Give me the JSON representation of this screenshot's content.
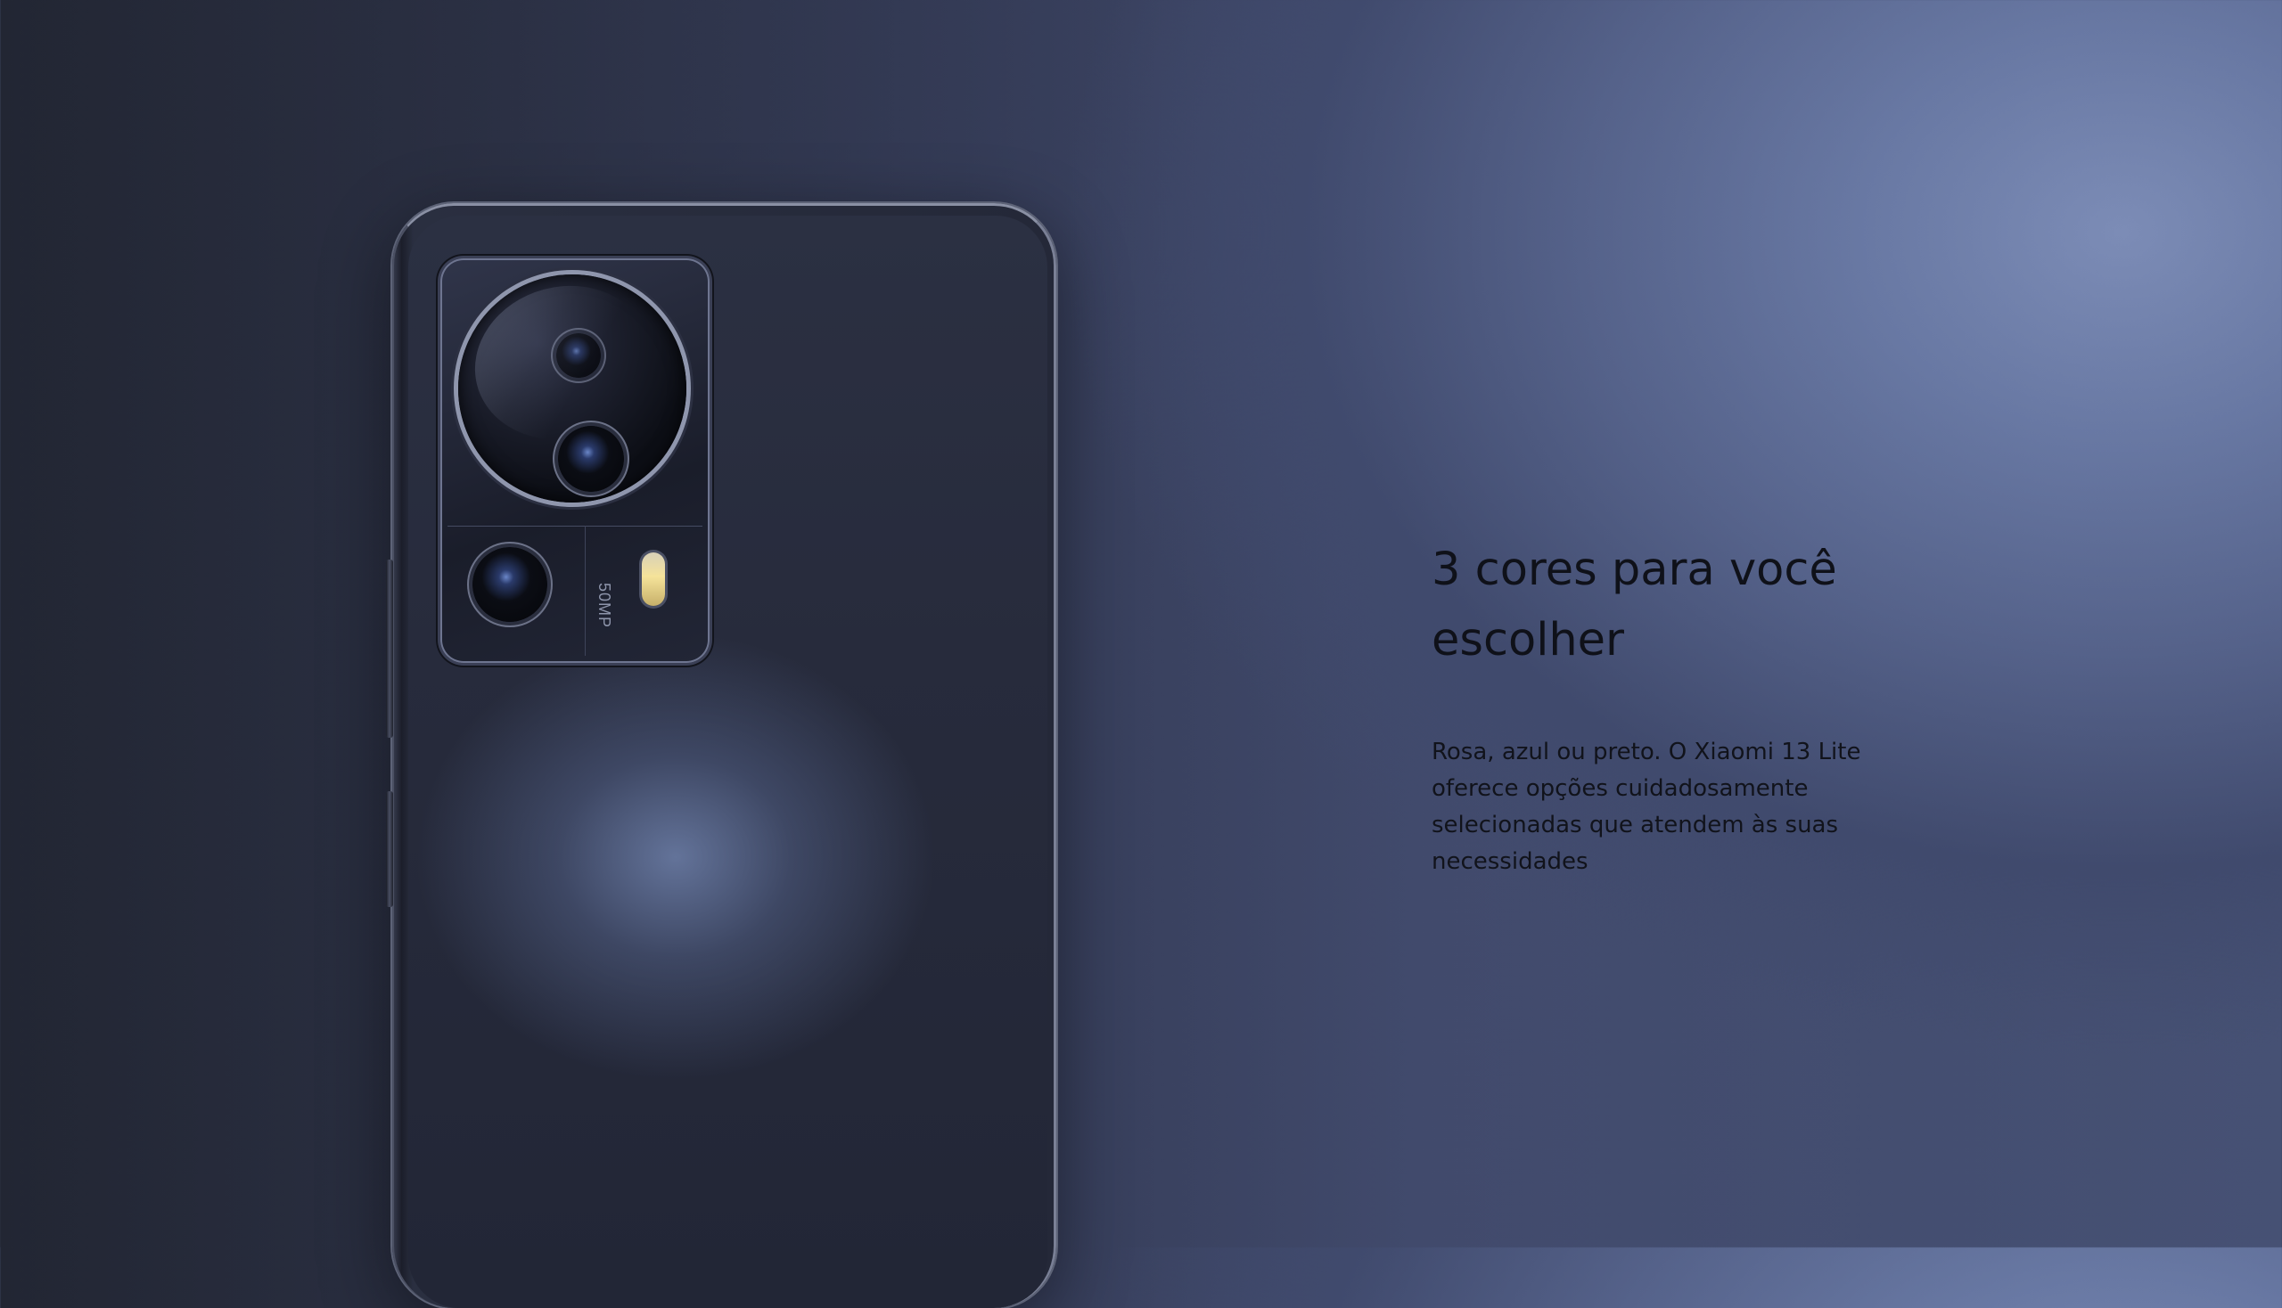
{
  "section": {
    "headline": "3 cores para você escolher",
    "description": "Rosa, azul ou preto. O Xiaomi 13 Lite oferece opções cuidadosamente selecionadas que atendem às suas necessidades"
  },
  "product": {
    "camera_label": "50MP"
  },
  "colors": {
    "background_highlight": "#7c8cb6",
    "background_dark": "#222633",
    "phone_body": "#272b3c",
    "text": "#0f1119"
  }
}
